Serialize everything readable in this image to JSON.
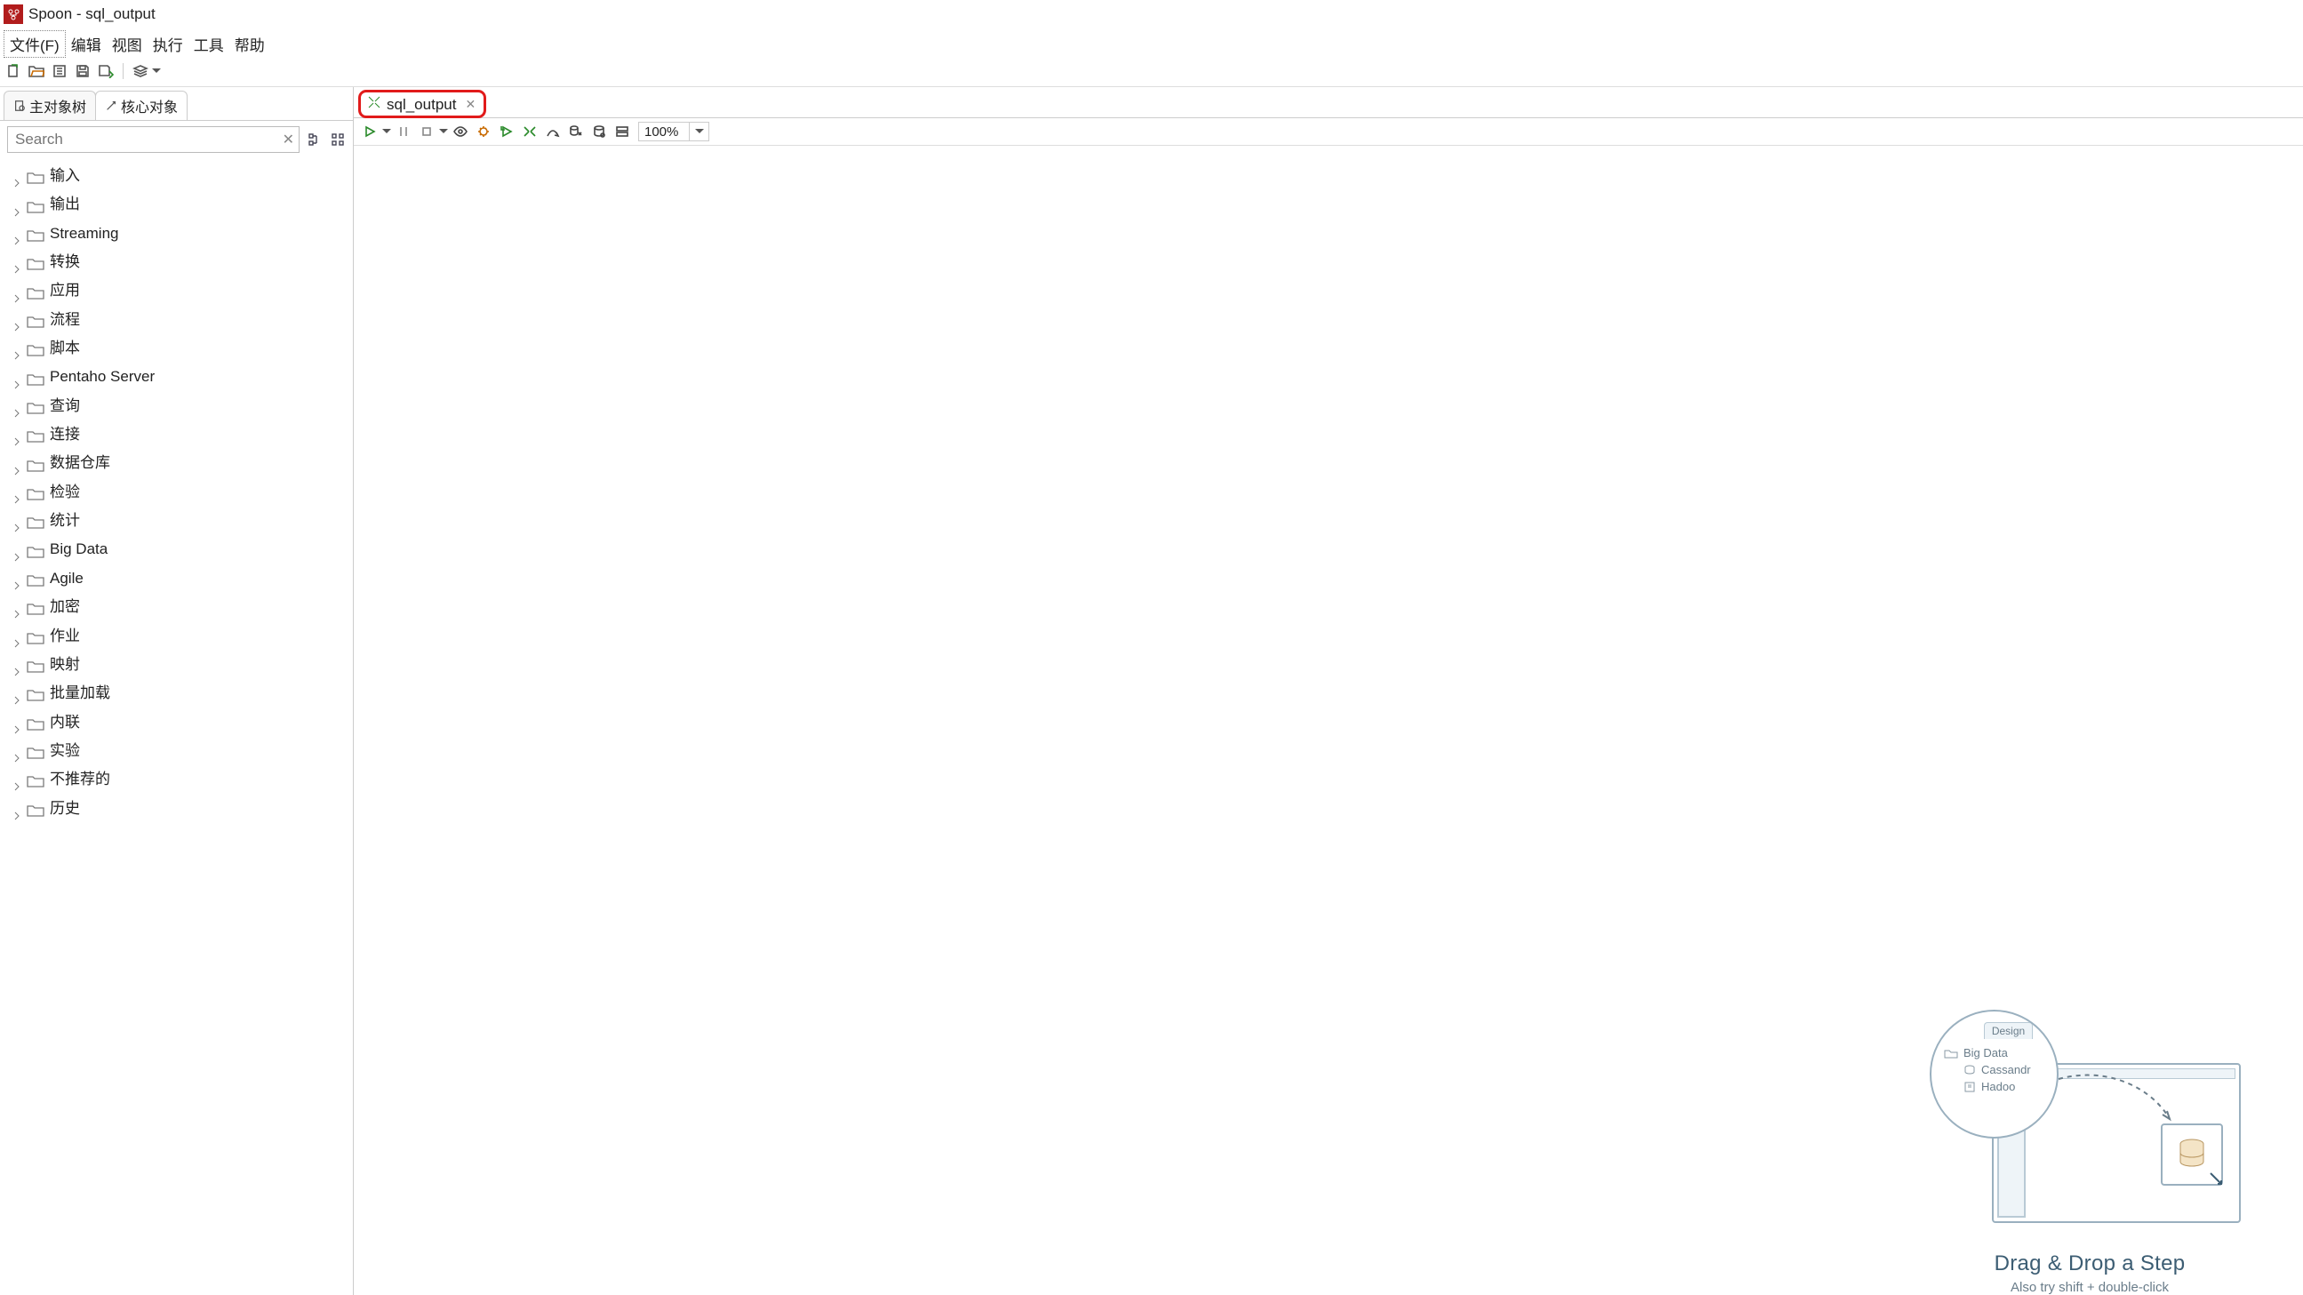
{
  "title": "Spoon - sql_output",
  "menu": {
    "file": "文件(F)",
    "edit": "编辑",
    "view": "视图",
    "run": "执行",
    "tools": "工具",
    "help": "帮助"
  },
  "left_tabs": {
    "tree": "主对象树",
    "core": "核心对象"
  },
  "search": {
    "placeholder": "Search"
  },
  "tree": [
    {
      "label": "输入"
    },
    {
      "label": "输出"
    },
    {
      "label": "Streaming"
    },
    {
      "label": "转换"
    },
    {
      "label": "应用"
    },
    {
      "label": "流程"
    },
    {
      "label": "脚本"
    },
    {
      "label": "Pentaho Server"
    },
    {
      "label": "查询"
    },
    {
      "label": "连接"
    },
    {
      "label": "数据仓库"
    },
    {
      "label": "检验"
    },
    {
      "label": "统计"
    },
    {
      "label": "Big Data"
    },
    {
      "label": "Agile"
    },
    {
      "label": "加密"
    },
    {
      "label": "作业"
    },
    {
      "label": "映射"
    },
    {
      "label": "批量加载"
    },
    {
      "label": "内联"
    },
    {
      "label": "实验"
    },
    {
      "label": "不推荐的"
    },
    {
      "label": "历史"
    }
  ],
  "editor_tab": {
    "label": "sql_output"
  },
  "zoom": {
    "value": "100%"
  },
  "hint": {
    "title": "Drag & Drop a Step",
    "subtitle": "Also try shift + double-click",
    "circle": {
      "tab": "Design",
      "row1": "Big Data",
      "row2": "Cassandr",
      "row3": "Hadoo"
    }
  }
}
